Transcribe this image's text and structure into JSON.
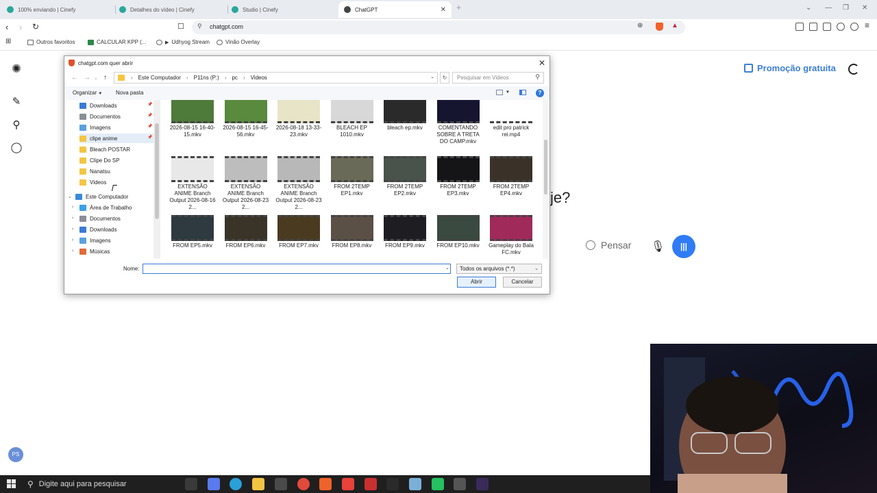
{
  "browser": {
    "tabs": [
      {
        "label": "100% enviando | Cinefy",
        "active": false,
        "color": "#2aa89a"
      },
      {
        "label": "Detalhes do vídeo | Cinefy",
        "active": false,
        "color": "#2aa89a"
      },
      {
        "label": "Studio | Cinefy",
        "active": false,
        "color": "#2aa89a"
      },
      {
        "label": "ChatGPT",
        "active": true,
        "color": "#444444"
      }
    ],
    "url": "chatgpt.com",
    "bookmarks": [
      "Outros favoritos",
      "CALCULAR KPP (...",
      "Udhyog Stream",
      "Vinão Overlay"
    ]
  },
  "chatgpt": {
    "promo_label": "Promoção gratuita",
    "heading_tail": "je?",
    "think_label": "Pensar",
    "avatar_initials": "PS",
    "voice_icon": "audio-bars-icon"
  },
  "dialog": {
    "title": "chatgpt.com quer abrir",
    "path": [
      "Este Computador",
      "P11ns (P:)",
      "pc",
      "Videos"
    ],
    "search_placeholder": "Pesquisar em Videos",
    "organize_label": "Organizar",
    "new_folder_label": "Nova pasta",
    "quick_access": [
      {
        "label": "Downloads",
        "icon": "download-icon",
        "color": "#3a7bd5",
        "pinned": true
      },
      {
        "label": "Documentos",
        "icon": "documents-icon",
        "color": "#8a8f99",
        "pinned": true
      },
      {
        "label": "Imagens",
        "icon": "images-icon",
        "color": "#5aa0e0",
        "pinned": true
      },
      {
        "label": "clipe anime",
        "icon": "folder-icon",
        "color": "#f4c542",
        "pinned": true,
        "selected": true
      },
      {
        "label": "Bleach POSTAR",
        "icon": "folder-icon",
        "color": "#f4c542"
      },
      {
        "label": "Clipe Do SP",
        "icon": "folder-icon",
        "color": "#f4c542"
      },
      {
        "label": "Nanatsu",
        "icon": "folder-icon",
        "color": "#f4c542"
      },
      {
        "label": "Videos",
        "icon": "folder-icon",
        "color": "#f4c542"
      }
    ],
    "this_pc": {
      "label": "Este Computador",
      "icon": "computer-icon"
    },
    "pc_items": [
      {
        "label": "Área de Trabalho",
        "icon": "desktop-icon",
        "color": "#3aa0e8"
      },
      {
        "label": "Documentos",
        "icon": "documents-icon",
        "color": "#8a8f99"
      },
      {
        "label": "Downloads",
        "icon": "download-icon",
        "color": "#3a7bd5"
      },
      {
        "label": "Imagens",
        "icon": "images-icon",
        "color": "#5aa0e0"
      },
      {
        "label": "Músicas",
        "icon": "music-icon",
        "color": "#e06a3a"
      }
    ],
    "files": [
      {
        "name": "2026-08-15 16-40-15.mkv",
        "tone": "#4e7a3a"
      },
      {
        "name": "2026-08-15 16-45-56.mkv",
        "tone": "#5a8a3e"
      },
      {
        "name": "2026-08-18 13-33-23.mkv",
        "tone": "#e8e4c8"
      },
      {
        "name": "BLEACH EP 1010.mkv",
        "tone": "#d8d8d8"
      },
      {
        "name": "bleach ep.mkv",
        "tone": "#2a2a2a"
      },
      {
        "name": "COMENTANDO SOBRE A TRETA DO CAMP.mkv",
        "tone": "#151530"
      },
      {
        "name": "edit pro patrick rei.mp4",
        "tone": "#ffffff"
      },
      {
        "name": "EXTENSÃO ANIME Branch Output 2026-08-16 2...",
        "tone": "#e8e8e8"
      },
      {
        "name": "EXTENSÃO ANIME Branch Output 2026-08-23 2...",
        "tone": "#bdbdbd"
      },
      {
        "name": "EXTENSÃO ANIME Branch Output 2026-08-23 2...",
        "tone": "#b8b8b8"
      },
      {
        "name": "FROM 2TEMP EP1.mkv",
        "tone": "#6a6a58"
      },
      {
        "name": "FROM 2TEMP EP2.mkv",
        "tone": "#4a524c"
      },
      {
        "name": "FROM 2TEMP EP3.mkv",
        "tone": "#151518"
      },
      {
        "name": "FROM 2TEMP EP4.mkv",
        "tone": "#3a3228"
      },
      {
        "name": "FROM EP5.mkv",
        "tone": "#2e3a40"
      },
      {
        "name": "FROM EP6.mkv",
        "tone": "#3a3428"
      },
      {
        "name": "FROM EP7.mkv",
        "tone": "#4a3a20"
      },
      {
        "name": "FROM EP8.mkv",
        "tone": "#5a5046"
      },
      {
        "name": "FROM EP9.mkv",
        "tone": "#1e1e22"
      },
      {
        "name": "FROM EP10.mkv",
        "tone": "#3a4a40"
      },
      {
        "name": "Gameplay do Bala FC.mkv",
        "tone": "#a02a5a"
      }
    ],
    "name_label": "Nome:",
    "name_value": "",
    "file_type": "Todos os arquivos (*.*)",
    "open_label": "Abrir",
    "cancel_label": "Cancelar"
  },
  "taskbar": {
    "search_placeholder": "Digite aqui para pesquisar",
    "apps": [
      {
        "name": "task-view-icon",
        "color": "#3a3a3a"
      },
      {
        "name": "copilot-icon",
        "color": "#5a7af0"
      },
      {
        "name": "edge-icon",
        "color": "#2aa0d8"
      },
      {
        "name": "file-explorer-icon",
        "color": "#f4c542"
      },
      {
        "name": "store-icon",
        "color": "#4a4a4a"
      },
      {
        "name": "chrome-icon",
        "color": "#e04a3a"
      },
      {
        "name": "brave-icon",
        "color": "#f0622a"
      },
      {
        "name": "vivaldi-icon",
        "color": "#e8423a"
      },
      {
        "name": "app-red-icon",
        "color": "#c83030"
      },
      {
        "name": "obs-icon",
        "color": "#2a2a2a"
      },
      {
        "name": "notes-icon",
        "color": "#7ab0d8"
      },
      {
        "name": "whatsapp-icon",
        "color": "#25c060"
      },
      {
        "name": "settings-icon",
        "color": "#555555"
      },
      {
        "name": "app-purple-icon",
        "color": "#3a2a5a"
      }
    ]
  }
}
